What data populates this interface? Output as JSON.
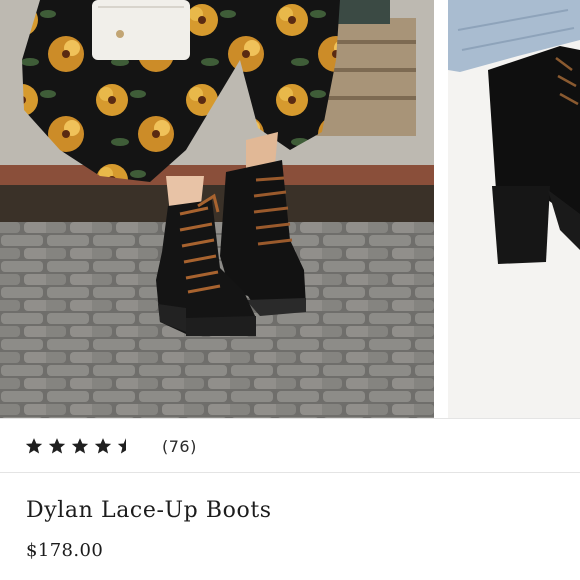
{
  "product": {
    "title": "Dylan Lace-Up Boots",
    "price": "$178.00",
    "rating": 4.5,
    "rating_max": 5,
    "review_count": "(76)"
  },
  "gallery": {
    "images": [
      {
        "name": "boots-street-photo"
      },
      {
        "name": "boots-closeup-photo"
      }
    ]
  },
  "colors": {
    "star": "#1f1f1f",
    "text": "#1c1c1c",
    "divider": "#e4e4e4"
  }
}
